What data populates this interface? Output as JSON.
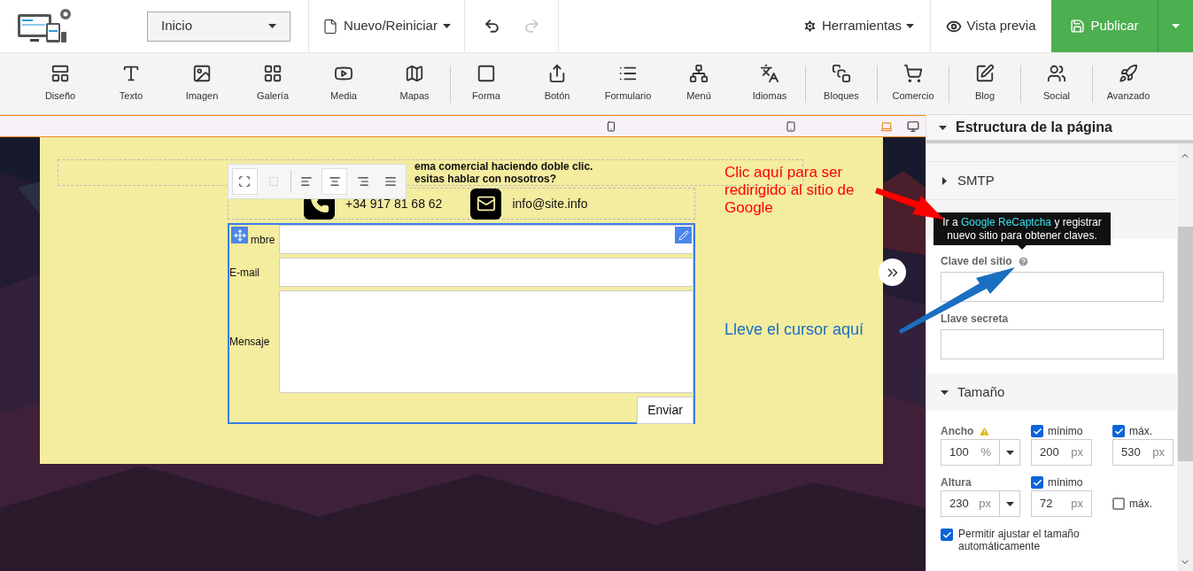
{
  "topbar": {
    "page_select": "Inicio",
    "new_menu": "Nuevo/Reiniciar",
    "undo_disabled": false,
    "redo_disabled": true,
    "tools": "Herramientas",
    "preview": "Vista previa",
    "publish": "Publicar"
  },
  "toolbar_groups": [
    [
      "Diseño",
      "Texto",
      "Imagen",
      "Galería",
      "Media",
      "Mapas"
    ],
    [
      "Forma",
      "Botón",
      "Formulario",
      "Menú",
      "Idiomas"
    ],
    [
      "Bloques"
    ],
    [
      "Comercio"
    ],
    [
      "Blog"
    ],
    [
      "Social"
    ],
    [
      "Avanzado"
    ]
  ],
  "canvas": {
    "intro_lines": [
      "ema comercial haciendo doble clic.",
      "esitas hablar con nosotros?"
    ],
    "phone": "+34 917 81 68 62",
    "email": "info@site.info",
    "form_fields": [
      {
        "label": "mbre",
        "kind": "line"
      },
      {
        "label": "E-mail",
        "kind": "line"
      },
      {
        "label": "Mensaje",
        "kind": "area"
      }
    ],
    "submit": "Enviar"
  },
  "annotations": [
    {
      "text": "Clic aquí para ser redirigido al sitio de Google",
      "color": "#ff0000"
    },
    {
      "text": "Lleve el cursor aquí",
      "color": "#1a6fc0"
    }
  ],
  "panel": {
    "title": "Estructura de la página",
    "sections": [
      {
        "label": "SMTP",
        "expanded": false
      }
    ],
    "tooltip": {
      "before": "Ir a",
      "link": "Google ReCaptcha",
      "after": "y registrar nuevo sitio para obtener claves."
    },
    "site_key_label": "Clave del sitio",
    "secret_key_label": "Llave secreta",
    "size": {
      "title": "Tamaño",
      "expanded": true,
      "width_label": "Ancho",
      "width_value": "100",
      "width_unit": "%",
      "width_min": {
        "label": "mínimo",
        "checked": true,
        "value": "200",
        "unit": "px"
      },
      "width_max": {
        "label": "máx.",
        "checked": true,
        "value": "530",
        "unit": "px"
      },
      "height_label": "Altura",
      "height_value": "230",
      "height_unit": "px",
      "height_min": {
        "label": "mínimo",
        "checked": true,
        "value": "72",
        "unit": "px"
      },
      "height_max": {
        "label": "máx.",
        "checked": false
      },
      "auto": {
        "label": "Permitir ajustar el tamaño automáticamente",
        "checked": true
      }
    }
  }
}
